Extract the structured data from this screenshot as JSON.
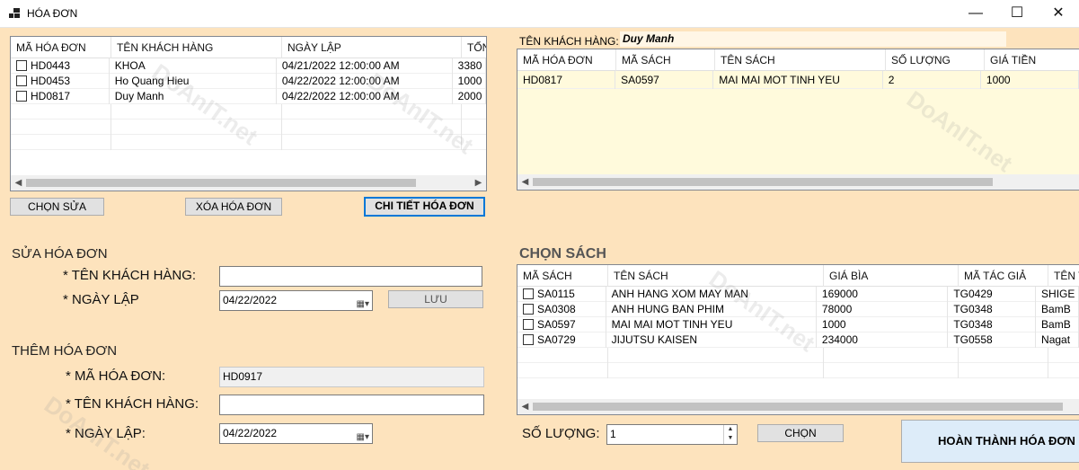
{
  "window": {
    "title": "HÓA ĐƠN",
    "minimize": "—",
    "maximize": "☐",
    "close": "✕"
  },
  "invoice_grid": {
    "headers": [
      "MÃ HÓA ĐƠN",
      "TÊN KHÁCH HÀNG",
      "NGÀY LẬP",
      "TỔNG"
    ],
    "rows": [
      [
        "HD0443",
        "KHOA",
        "04/21/2022 12:00:00 AM",
        "3380"
      ],
      [
        "HD0453",
        "Ho Quang Hieu",
        "04/22/2022 12:00:00 AM",
        "1000"
      ],
      [
        "HD0817",
        "Duy Manh",
        "04/22/2022 12:00:00 AM",
        "2000"
      ]
    ]
  },
  "buttons": {
    "edit": "CHỌN SỬA",
    "delete": "XÓA HÓA ĐƠN",
    "details": "CHI TIẾT HÓA ĐƠN",
    "save": "LƯU",
    "choose": "CHỌN",
    "complete": "HOÀN THÀNH HÓA ĐƠN"
  },
  "detail": {
    "customer_label": "TÊN KHÁCH HÀNG:",
    "customer_value": "Duy Manh",
    "headers": [
      "MÃ HÓA ĐƠN",
      "MÃ SÁCH",
      "TÊN SÁCH",
      "SỐ LƯỢNG",
      "GIÁ TIỀN"
    ],
    "rows": [
      [
        "HD0817",
        "SA0597",
        "MAI MAI MOT TINH YEU",
        "2",
        "1000"
      ]
    ]
  },
  "edit_form": {
    "title": "SỬA HÓA ĐƠN",
    "customer_label": "* TÊN KHÁCH HÀNG:",
    "customer_value": "",
    "date_label": "* NGÀY LẬP",
    "date_value": "04/22/2022"
  },
  "add_form": {
    "title": "THÊM HÓA ĐƠN",
    "code_label": "* MÃ HÓA ĐƠN:",
    "code_value": "HD0917",
    "customer_label": "* TÊN KHÁCH HÀNG:",
    "customer_value": "",
    "date_label": "* NGÀY LẬP:",
    "date_value": "04/22/2022"
  },
  "books": {
    "title": "CHỌN SÁCH",
    "headers": [
      "MÃ SÁCH",
      "TÊN SÁCH",
      "GIÁ BÌA",
      "MÃ TÁC GIẢ",
      "TÊN T"
    ],
    "rows": [
      [
        "SA0115",
        "ANH HANG XOM MAY MAN",
        "169000",
        "TG0429",
        "SHIGE"
      ],
      [
        "SA0308",
        "ANH HUNG BAN PHIM",
        "78000",
        "TG0348",
        "BamB"
      ],
      [
        "SA0597",
        "MAI MAI MOT TINH YEU",
        "1000",
        "TG0348",
        "BamB"
      ],
      [
        "SA0729",
        "JIJUTSU KAISEN",
        "234000",
        "TG0558",
        "Nagat"
      ]
    ]
  },
  "quantity": {
    "label": "SỐ LƯỢNG:",
    "value": "1"
  },
  "watermark": "DoAnIT.net",
  "colors": {
    "form_bg": "#fde3bd",
    "selected_row": "#fffadc",
    "focus_border": "#0078d7"
  }
}
